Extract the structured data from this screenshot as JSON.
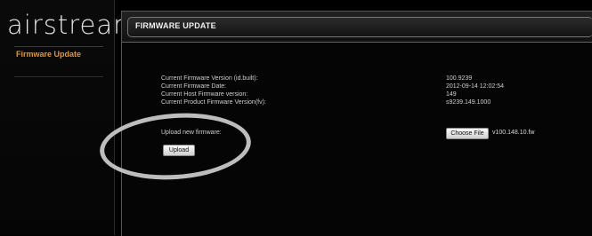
{
  "sidebar": {
    "logo": "airstream",
    "items": [
      {
        "label": "Firmware Update"
      }
    ]
  },
  "panel": {
    "title": "FIRMWARE UPDATE",
    "rows": [
      {
        "label": "Current Firmware Version (id.built):",
        "value": "100.9239"
      },
      {
        "label": "Current Firmware Date:",
        "value": "2012-09-14  12:02:54"
      },
      {
        "label": "Current Host Firmware version:",
        "value": "149"
      },
      {
        "label": "Current Product Firmware Version(fv):",
        "value": "s9239.149.1000"
      }
    ],
    "upload": {
      "label": "Upload new firmware:",
      "upload_button": "Upload",
      "choose_button": "Choose File",
      "file_name": "v100.148.10.fw"
    }
  },
  "colors": {
    "accent": "#e8942a",
    "background": "#000000",
    "annotation": "#bdbdbd"
  }
}
